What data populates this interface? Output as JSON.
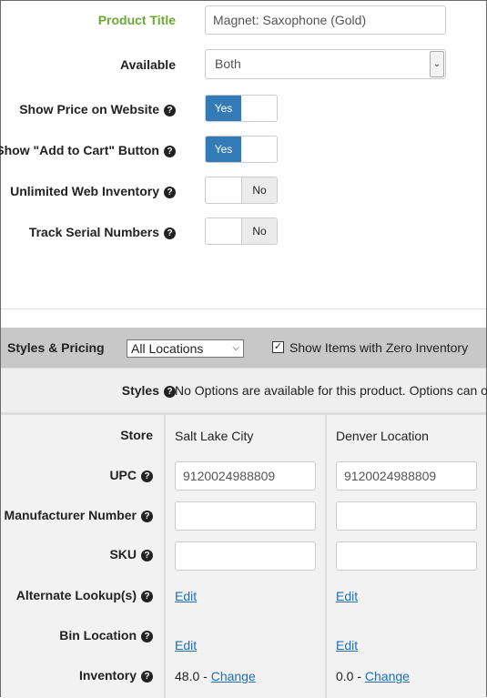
{
  "form": {
    "product_title_label": "Product Title",
    "product_title_value": "Magnet: Saxophone (Gold)",
    "available_label": "Available",
    "available_value": "Both",
    "show_price_label": "Show Price on Website",
    "show_price_value": "Yes",
    "show_cart_label": "Show \"Add to Cart\" Button",
    "show_cart_value": "Yes",
    "unlimited_label": "Unlimited Web Inventory",
    "unlimited_value": "No",
    "serial_label": "Track Serial Numbers",
    "serial_value": "No"
  },
  "toolbar": {
    "title": "Styles & Pricing",
    "location_select": "All Locations",
    "zero_inventory_label": "Show Items with Zero Inventory",
    "zero_inventory_checked": true
  },
  "styles": {
    "label": "Styles",
    "message": "No Options are available for this product. Options can o"
  },
  "grid": {
    "labels": {
      "store": "Store",
      "upc": "UPC",
      "manufacturer": "Manufacturer Number",
      "sku": "SKU",
      "alternate": "Alternate Lookup(s)",
      "bin": "Bin Location",
      "inventory": "Inventory"
    },
    "stores": [
      {
        "name": "Salt Lake City",
        "upc": "9120024988809",
        "manufacturer": "",
        "sku": "",
        "alternate_link": "Edit",
        "bin_link": "Edit",
        "inventory": "48.0 - ",
        "change_link": "Change"
      },
      {
        "name": "Denver Location",
        "upc": "9120024988809",
        "manufacturer": "",
        "sku": "",
        "alternate_link": "Edit",
        "bin_link": "Edit",
        "inventory": "0.0 - ",
        "change_link": "Change"
      }
    ]
  },
  "icons": {
    "help": "question-circle-icon",
    "dropdown": "chevron-down-icon",
    "check": "checkmark-icon"
  },
  "colors": {
    "title_label": "#6aaa32",
    "toggle_on": "#337ab7",
    "link": "#1f6fb5",
    "toolbar": "#c8c8c8"
  }
}
